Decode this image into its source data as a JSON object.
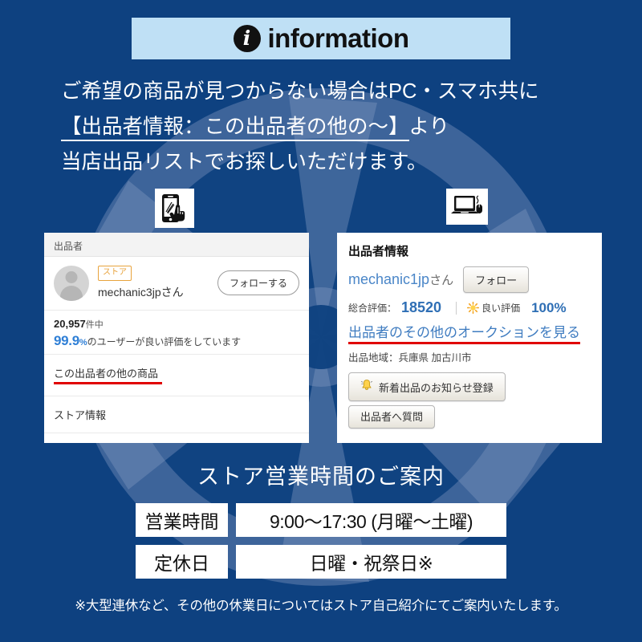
{
  "banner": {
    "icon": "information-circle-icon",
    "title": "information"
  },
  "intro": {
    "line1": "ご希望の商品が見つからない場合はPC・スマホ共に",
    "line2_underlined": "【出品者情報：この出品者の他の〜】",
    "line2_tail": "より",
    "line3": "当店出品リストでお探しいただけます。"
  },
  "device_icons": {
    "phone": "smartphone-tap-icon",
    "pc": "laptop-mouse-icon"
  },
  "sp_card": {
    "header": "出品者",
    "avatar": "seller-avatar-placeholder",
    "store_badge": "ストア",
    "seller_name": "mechanic3jpさん",
    "follow_button": "フォローする",
    "rating_count": "20,957",
    "rating_count_unit": "件中",
    "rating_pct": "99.9",
    "rating_pct_sign": "%",
    "rating_pct_tail": "のユーザーが良い評価をしています",
    "other_items_link": "この出品者の他の商品",
    "store_info_link": "ストア情報",
    "highlight_color": "#e00000"
  },
  "pc_card": {
    "title": "出品者情報",
    "seller_name": "mechanic1jp",
    "seller_name_suffix": "さん",
    "follow_button": "フォロー",
    "total_rating_label": "総合評価：",
    "total_rating_value": "18520",
    "good_rating_label": "良い評価",
    "good_rating_value": "100%",
    "sun_icon": "sun-icon",
    "auction_link": "出品者のその他のオークションを見る",
    "area_line": "出品地域：兵庫県 加古川市",
    "notify_button": "新着出品のお知らせ登録",
    "notify_icon": "bell-icon",
    "question_button": "出品者へ質問",
    "highlight_color": "#e00000"
  },
  "hours": {
    "title": "ストア営業時間のご案内",
    "rows": [
      {
        "label": "営業時間",
        "value": "9:00〜17:30 (月曜〜土曜)"
      },
      {
        "label": "定休日",
        "value": "日曜・祝祭日※"
      }
    ]
  },
  "footnote": "※大型連休など、その他の休業日についてはストア自己紹介にてご案内いたします。",
  "theme": {
    "background": "#0e4180",
    "banner_bg": "#bfe0f5",
    "pattern": "#3f5f98"
  }
}
